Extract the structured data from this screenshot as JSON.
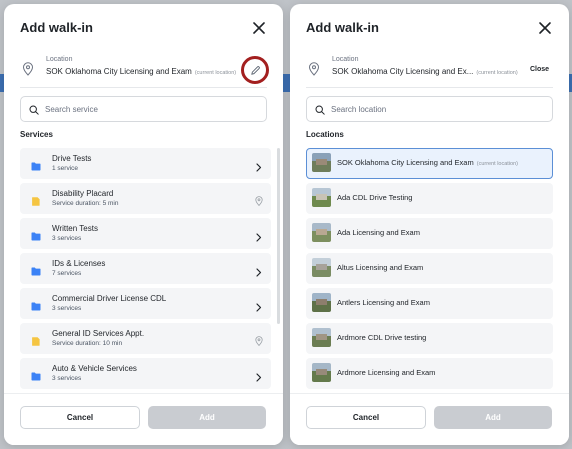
{
  "left_modal": {
    "title": "Add walk-in",
    "location": {
      "label": "Location",
      "value": "SOK Oklahoma City Licensing and Exam",
      "tag": "(current location)"
    },
    "search": {
      "placeholder": "Search service"
    },
    "section_title": "Services",
    "services": [
      {
        "name": "Drive Tests",
        "sub": "1 service",
        "icon": "folder-icon",
        "action": "chevron-right-icon"
      },
      {
        "name": "Disability Placard",
        "sub": "Service duration: 5 min",
        "icon": "document-icon",
        "action": "location-pin-icon"
      },
      {
        "name": "Written Tests",
        "sub": "3 services",
        "icon": "folder-icon",
        "action": "chevron-right-icon"
      },
      {
        "name": "IDs & Licenses",
        "sub": "7 services",
        "icon": "folder-icon",
        "action": "chevron-right-icon"
      },
      {
        "name": "Commercial Driver License CDL",
        "sub": "3 services",
        "icon": "folder-icon",
        "action": "chevron-right-icon"
      },
      {
        "name": "General ID Services Appt.",
        "sub": "Service duration: 10 min",
        "icon": "document-icon",
        "action": "location-pin-icon"
      },
      {
        "name": "Auto & Vehicle Services",
        "sub": "3 services",
        "icon": "folder-icon",
        "action": "chevron-right-icon"
      }
    ],
    "cancel_label": "Cancel",
    "add_label": "Add"
  },
  "right_modal": {
    "title": "Add walk-in",
    "location": {
      "label": "Location",
      "value": "SOK Oklahoma City Licensing and Ex...",
      "tag": "(current location)",
      "close_label": "Close"
    },
    "search": {
      "placeholder": "Search location"
    },
    "section_title": "Locations",
    "locations": [
      {
        "name": "SOK Oklahoma City Licensing and Exam",
        "tag": "(current location)",
        "selected": true
      },
      {
        "name": "Ada CDL Drive Testing",
        "tag": "",
        "selected": false
      },
      {
        "name": "Ada Licensing and Exam",
        "tag": "",
        "selected": false
      },
      {
        "name": "Altus Licensing and Exam",
        "tag": "",
        "selected": false
      },
      {
        "name": "Antlers Licensing and Exam",
        "tag": "",
        "selected": false
      },
      {
        "name": "Ardmore CDL Drive testing",
        "tag": "",
        "selected": false
      },
      {
        "name": "Ardmore Licensing and Exam",
        "tag": "",
        "selected": false
      }
    ],
    "cancel_label": "Cancel",
    "add_label": "Add"
  },
  "colors": {
    "folder_icon": "#3b82f6",
    "document_icon": "#f5c542",
    "highlight_ring": "#a31f1f",
    "selected_border": "#5b8fd6",
    "disabled_button": "#c9ccd1"
  }
}
